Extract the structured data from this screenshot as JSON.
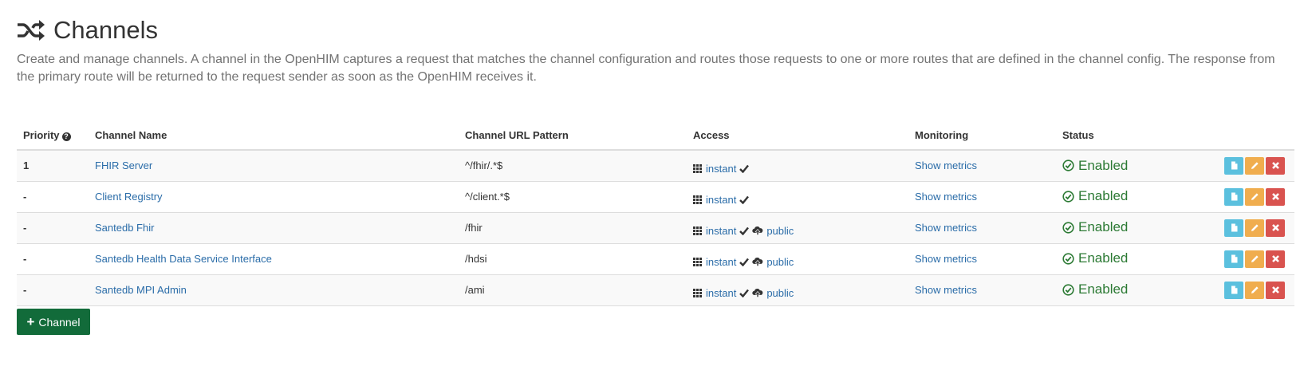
{
  "header": {
    "title": "Channels",
    "title_icon": "shuffle-icon",
    "description": "Create and manage channels. A channel in the OpenHIM captures a request that matches the channel configuration and routes those requests to one or more routes that are defined in the channel config. The response from the primary route will be returned to the request sender as soon as the OpenHIM receives it."
  },
  "table": {
    "columns": {
      "priority": "Priority",
      "name": "Channel Name",
      "url": "Channel URL Pattern",
      "access": "Access",
      "monitoring": "Monitoring",
      "status": "Status"
    },
    "rows": [
      {
        "priority": "1",
        "name": "FHIR Server",
        "url": "^/fhir/.*$",
        "access_role": "instant",
        "public": "",
        "monitoring": "Show metrics",
        "status": "Enabled"
      },
      {
        "priority": "-",
        "name": "Client Registry",
        "url": "^/client.*$",
        "access_role": "instant",
        "public": "",
        "monitoring": "Show metrics",
        "status": "Enabled"
      },
      {
        "priority": "-",
        "name": "Santedb Fhir",
        "url": "/fhir",
        "access_role": "instant",
        "public": "public",
        "monitoring": "Show metrics",
        "status": "Enabled"
      },
      {
        "priority": "-",
        "name": "Santedb Health Data Service Interface",
        "url": "/hdsi",
        "access_role": "instant",
        "public": "public",
        "monitoring": "Show metrics",
        "status": "Enabled"
      },
      {
        "priority": "-",
        "name": "Santedb MPI Admin",
        "url": "/ami",
        "access_role": "instant",
        "public": "public",
        "monitoring": "Show metrics",
        "status": "Enabled"
      }
    ]
  },
  "add_button": {
    "label": "Channel",
    "icon": "plus-icon"
  },
  "colors": {
    "link": "#2a6ca8",
    "enabled": "#2c7a34",
    "btn_view": "#5bc0de",
    "btn_edit": "#f0ad4e",
    "btn_delete": "#d9534f",
    "btn_add": "#126b3a"
  }
}
